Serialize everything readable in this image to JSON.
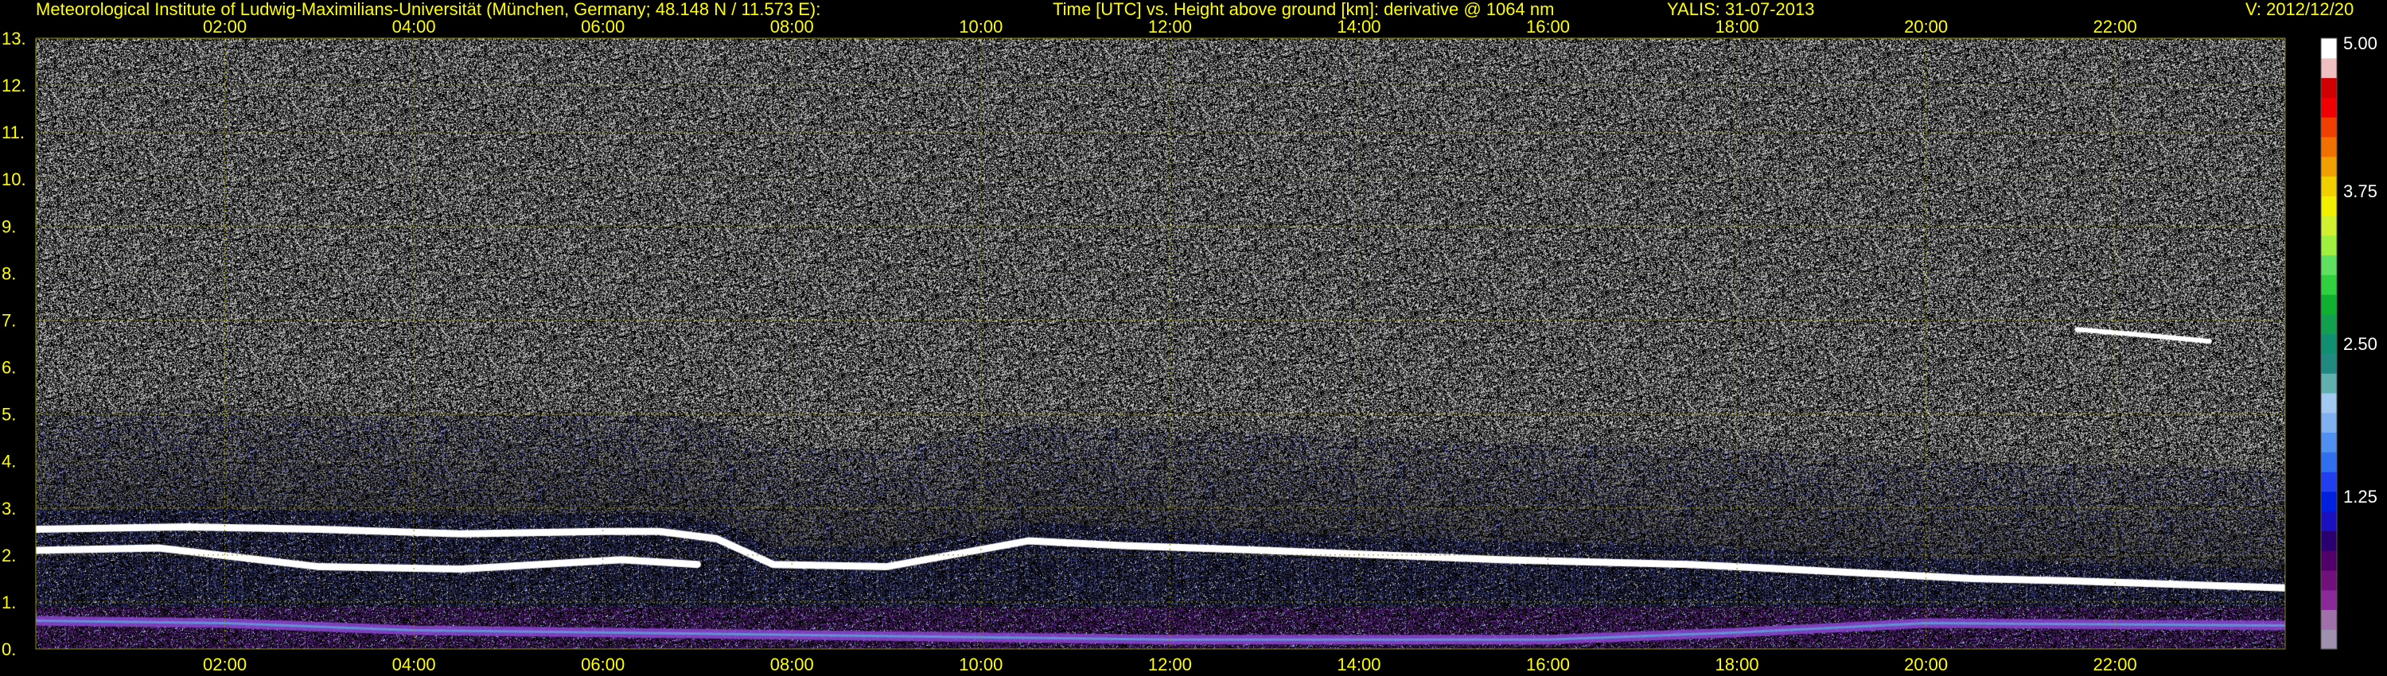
{
  "header": {
    "institute": "Meteorological Institute of Ludwig-Maximilians-Universität (München, Germany; 48.148 N / 11.573 E):",
    "description": "Time [UTC] vs. Height above ground [km]: derivative @ 1064 nm",
    "station_date": "YALIS: 31-07-2013",
    "version": "V: 2012/12/20"
  },
  "colors": {
    "background": "#000000",
    "axis_text": "#ffff00",
    "grid": "#8a8a00",
    "colorbar_text": "#ffffff"
  },
  "chart_data": {
    "type": "heatmap",
    "title": "Time [UTC] vs. Height above ground [km]: derivative @ 1064 nm",
    "x_unit": "hours UTC",
    "y_unit": "km",
    "xlim": [
      0,
      23.8
    ],
    "ylim": [
      0,
      13
    ],
    "x_ticks": [
      2,
      4,
      6,
      8,
      10,
      12,
      14,
      16,
      18,
      20,
      22
    ],
    "x_tick_labels": [
      "02:00",
      "04:00",
      "06:00",
      "08:00",
      "10:00",
      "12:00",
      "14:00",
      "16:00",
      "18:00",
      "20:00",
      "22:00"
    ],
    "y_ticks": [
      0,
      1,
      2,
      3,
      4,
      5,
      6,
      7,
      8,
      9,
      10,
      11,
      12,
      13
    ],
    "y_tick_labels": [
      "0.",
      "1.",
      "2.",
      "3.",
      "4.",
      "5.",
      "6.",
      "7.",
      "8.",
      "9.",
      "10.",
      "11.",
      "12.",
      "13."
    ],
    "grid": true,
    "colorbar": {
      "range": [
        0,
        5
      ],
      "tick_values": [
        1.25,
        2.5,
        3.75,
        5.0
      ],
      "tick_labels": [
        "1.25",
        "2.50",
        "3.75",
        "5.00"
      ],
      "colors": [
        "#a090b0",
        "#a070a8",
        "#8a2a9a",
        "#70107a",
        "#500068",
        "#2a0070",
        "#1a10c0",
        "#0020e0",
        "#2040f0",
        "#3070f0",
        "#5090f0",
        "#80b0f0",
        "#a0c8f0",
        "#60b0b0",
        "#208a80",
        "#109070",
        "#10a050",
        "#10b030",
        "#30d040",
        "#60e060",
        "#a0f040",
        "#d0f030",
        "#f0f000",
        "#f0d000",
        "#f0a000",
        "#f07000",
        "#f04000",
        "#f00000",
        "#d00000",
        "#f0c0c0",
        "#ffffff"
      ]
    },
    "features": [
      {
        "kind": "boundary_layer_top",
        "points": [
          [
            0,
            2.55
          ],
          [
            1.6,
            2.6
          ],
          [
            3,
            2.55
          ],
          [
            4.5,
            2.45
          ],
          [
            6,
            2.5
          ],
          [
            6.6,
            2.5
          ],
          [
            7.2,
            2.35
          ],
          [
            7.8,
            1.8
          ],
          [
            9,
            1.75
          ],
          [
            10.5,
            2.3
          ],
          [
            11.5,
            2.2
          ],
          [
            13,
            2.1
          ],
          [
            15.5,
            1.9
          ],
          [
            17.5,
            1.8
          ],
          [
            18.5,
            1.7
          ],
          [
            19.5,
            1.6
          ],
          [
            20.5,
            1.5
          ],
          [
            21.5,
            1.45
          ],
          [
            23.8,
            1.3
          ]
        ]
      },
      {
        "kind": "residual_layer",
        "points": [
          [
            0,
            2.1
          ],
          [
            1.3,
            2.15
          ],
          [
            3,
            1.75
          ],
          [
            4.5,
            1.7
          ],
          [
            6.2,
            1.9
          ],
          [
            7,
            1.8
          ]
        ]
      },
      {
        "kind": "surface_layer",
        "points": [
          [
            0,
            0.6
          ],
          [
            2,
            0.55
          ],
          [
            4,
            0.4
          ],
          [
            6,
            0.35
          ],
          [
            8,
            0.3
          ],
          [
            12,
            0.2
          ],
          [
            16,
            0.2
          ],
          [
            18,
            0.35
          ],
          [
            20,
            0.55
          ],
          [
            23.8,
            0.5
          ]
        ]
      },
      {
        "kind": "elevated_layer",
        "points": [
          [
            21.6,
            6.8
          ],
          [
            22.2,
            6.7
          ],
          [
            23.0,
            6.55
          ]
        ]
      }
    ]
  }
}
